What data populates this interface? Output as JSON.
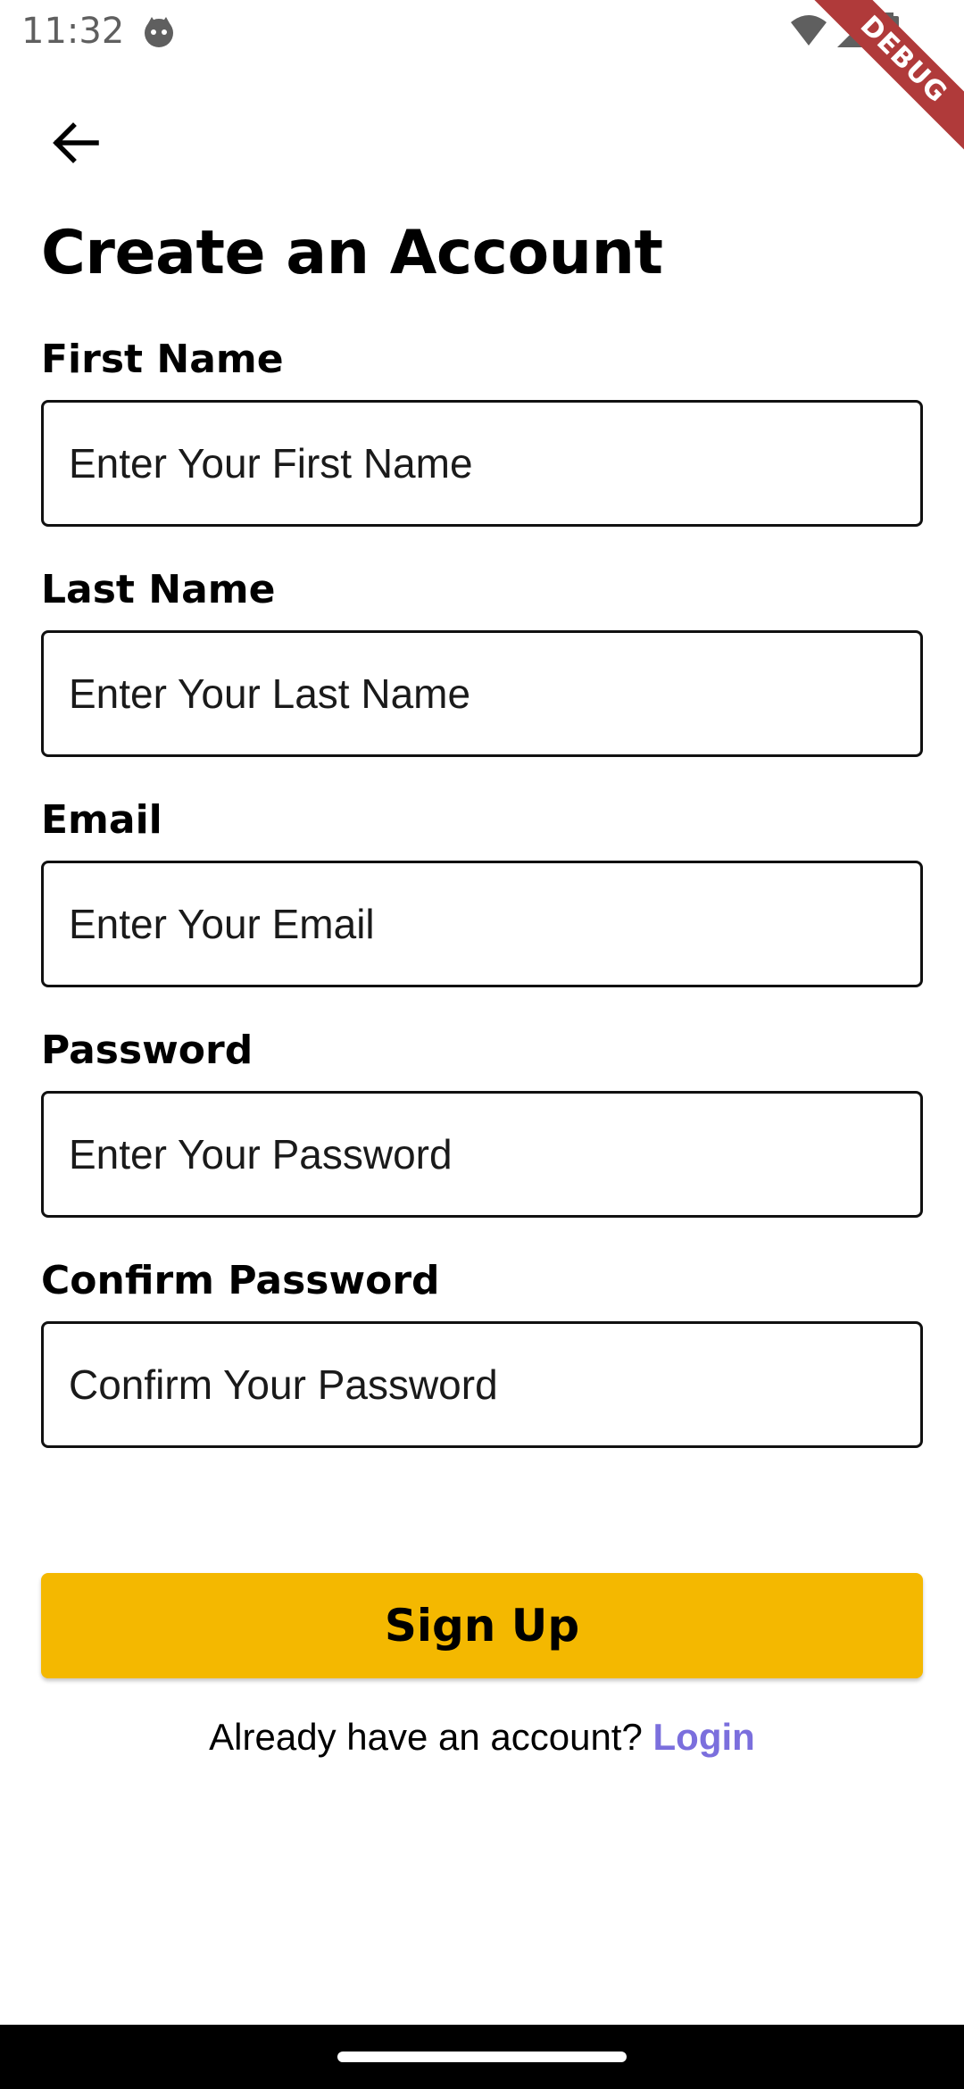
{
  "status_bar": {
    "time": "11:32",
    "debug_label": "DEBUG"
  },
  "header": {
    "title": "Create an Account"
  },
  "form": {
    "fields": [
      {
        "label": "First Name",
        "placeholder": "Enter Your First Name",
        "value": ""
      },
      {
        "label": "Last Name",
        "placeholder": "Enter Your Last Name",
        "value": ""
      },
      {
        "label": "Email",
        "placeholder": "Enter Your Email",
        "value": ""
      },
      {
        "label": "Password",
        "placeholder": "Enter Your Password",
        "value": ""
      },
      {
        "label": "Confirm Password",
        "placeholder": "Confirm Your Password",
        "value": ""
      }
    ],
    "submit_label": "Sign Up"
  },
  "footer": {
    "prompt": "Already have an account?",
    "login_label": "Login"
  },
  "colors": {
    "accent": "#f4b800",
    "link": "#7b6fdd",
    "debug_banner": "#b03a3a"
  },
  "icons": {
    "back": "arrow-left-icon",
    "app": "face-icon",
    "wifi": "wifi-icon",
    "signal": "signal-icon",
    "battery": "battery-icon"
  }
}
